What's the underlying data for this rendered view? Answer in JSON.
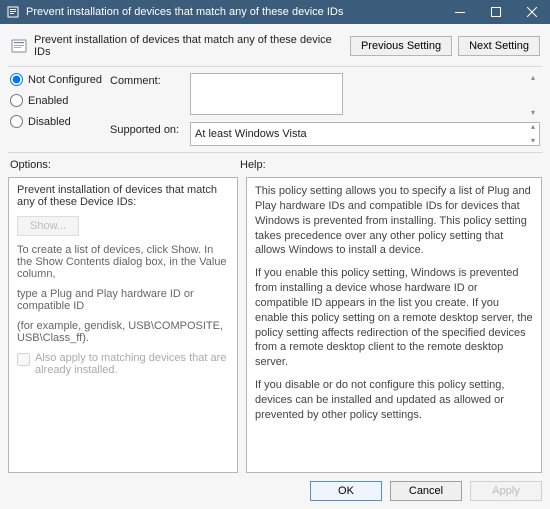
{
  "window": {
    "title": "Prevent installation of devices that match any of these device IDs"
  },
  "header": {
    "policy_title": "Prevent installation of devices that match any of these device IDs",
    "prev_btn": "Previous Setting",
    "next_btn": "Next Setting"
  },
  "state": {
    "not_configured": "Not Configured",
    "enabled": "Enabled",
    "disabled": "Disabled",
    "comment_label": "Comment:",
    "comment_value": "",
    "supported_label": "Supported on:",
    "supported_value": "At least Windows Vista"
  },
  "mid": {
    "options_label": "Options:",
    "help_label": "Help:"
  },
  "options": {
    "title": "Prevent installation of devices that match any of these Device IDs:",
    "show_btn": "Show...",
    "hint1": "To create a list of devices, click Show. In the Show Contents dialog box, in the Value column,",
    "hint2": "type a Plug and Play hardware ID or compatible ID",
    "hint3": "(for example, gendisk, USB\\COMPOSITE, USB\\Class_ff).",
    "also_apply": "Also apply to matching devices that are already installed."
  },
  "help": {
    "p1": "This policy setting allows you to specify a list of Plug and Play hardware IDs and compatible IDs for devices that Windows is prevented from installing. This policy setting takes precedence over any other policy setting that allows Windows to install a device.",
    "p2": "If you enable this policy setting, Windows is prevented from installing a device whose hardware ID or compatible ID appears in the list you create. If you enable this policy setting on a remote desktop server, the policy setting affects redirection of the specified devices from a remote desktop client to the remote desktop server.",
    "p3": "If you disable or do not configure this policy setting, devices can be installed and updated as allowed or prevented by other policy settings."
  },
  "footer": {
    "ok": "OK",
    "cancel": "Cancel",
    "apply": "Apply"
  }
}
